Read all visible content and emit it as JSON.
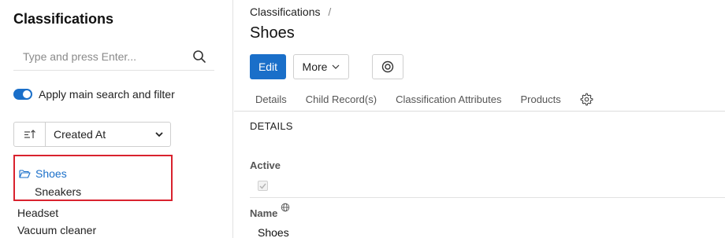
{
  "sidebar": {
    "title": "Classifications",
    "search": {
      "placeholder": "Type and press Enter...",
      "value": ""
    },
    "toggle": {
      "label": "Apply main search and filter",
      "on": true
    },
    "sort": {
      "selected": "Created At"
    },
    "tree": [
      {
        "label": "Shoes",
        "children": [
          {
            "label": "Sneakers"
          }
        ]
      },
      {
        "label": "Headset"
      },
      {
        "label": "Vacuum cleaner"
      }
    ]
  },
  "main": {
    "breadcrumb": {
      "root": "Classifications",
      "separator": "/"
    },
    "title": "Shoes",
    "actions": {
      "edit": "Edit",
      "more": "More"
    },
    "tabs": [
      {
        "label": "Details"
      },
      {
        "label": "Child Record(s)"
      },
      {
        "label": "Classification Attributes"
      },
      {
        "label": "Products"
      }
    ],
    "section": "DETAILS",
    "fields": {
      "active": {
        "label": "Active",
        "checked": true
      },
      "name": {
        "label": "Name",
        "value": "Shoes"
      }
    }
  },
  "colors": {
    "accent": "#1a6fc9",
    "highlight_border": "#d9222e"
  }
}
